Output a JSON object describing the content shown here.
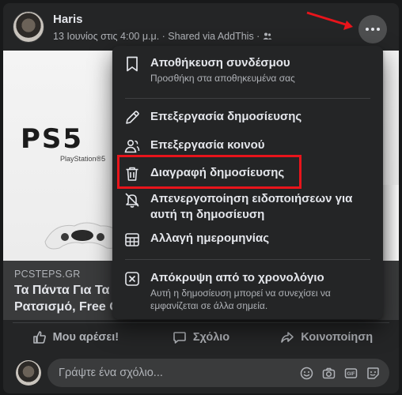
{
  "post": {
    "author": "Haris",
    "meta": "13 Ιουνίος στις 4:00 μ.μ. · Shared via AddThis ·"
  },
  "image": {
    "brand": "PS5",
    "sub": "PlayStation®5"
  },
  "link": {
    "domain": "PCSTEPS.GR",
    "title_line1": "Τα Πάντα Για Τα",
    "title_line2": "Ρατσισμό, Free G"
  },
  "actions": {
    "like": "Μου αρέσει!",
    "comment": "Σχόλιο",
    "share": "Κοινοποίηση"
  },
  "comment": {
    "placeholder": "Γράψτε ένα σχόλιο..."
  },
  "menu": {
    "items": [
      {
        "label": "Αποθήκευση συνδέσμου",
        "sub": "Προσθήκη στα αποθηκευμένα σας",
        "icon": "bookmark-icon"
      },
      {
        "label": "Επεξεργασία δημοσίευσης",
        "icon": "pencil-icon"
      },
      {
        "label": "Επεξεργασία κοινού",
        "icon": "audience-icon"
      },
      {
        "label": "Διαγραφή δημοσίευσης",
        "icon": "trash-icon"
      },
      {
        "label_line1": "Απενεργοποίηση ειδοποιήσεων για",
        "label_line2": "αυτή τη δημοσίευση",
        "icon": "bell-off-icon"
      },
      {
        "label": "Αλλαγή ημερομηνίας",
        "icon": "calendar-icon"
      },
      {
        "label": "Απόκρυψη από το χρονολόγιο",
        "sub_line1": "Αυτή η δημοσίευση μπορεί να συνεχίσει να",
        "sub_line2": "εμφανίζεται σε άλλα σημεία.",
        "icon": "hide-box-icon"
      }
    ]
  },
  "colors": {
    "highlight": "#e8141b",
    "menu_bg": "#242526",
    "card_bg": "#242526"
  }
}
